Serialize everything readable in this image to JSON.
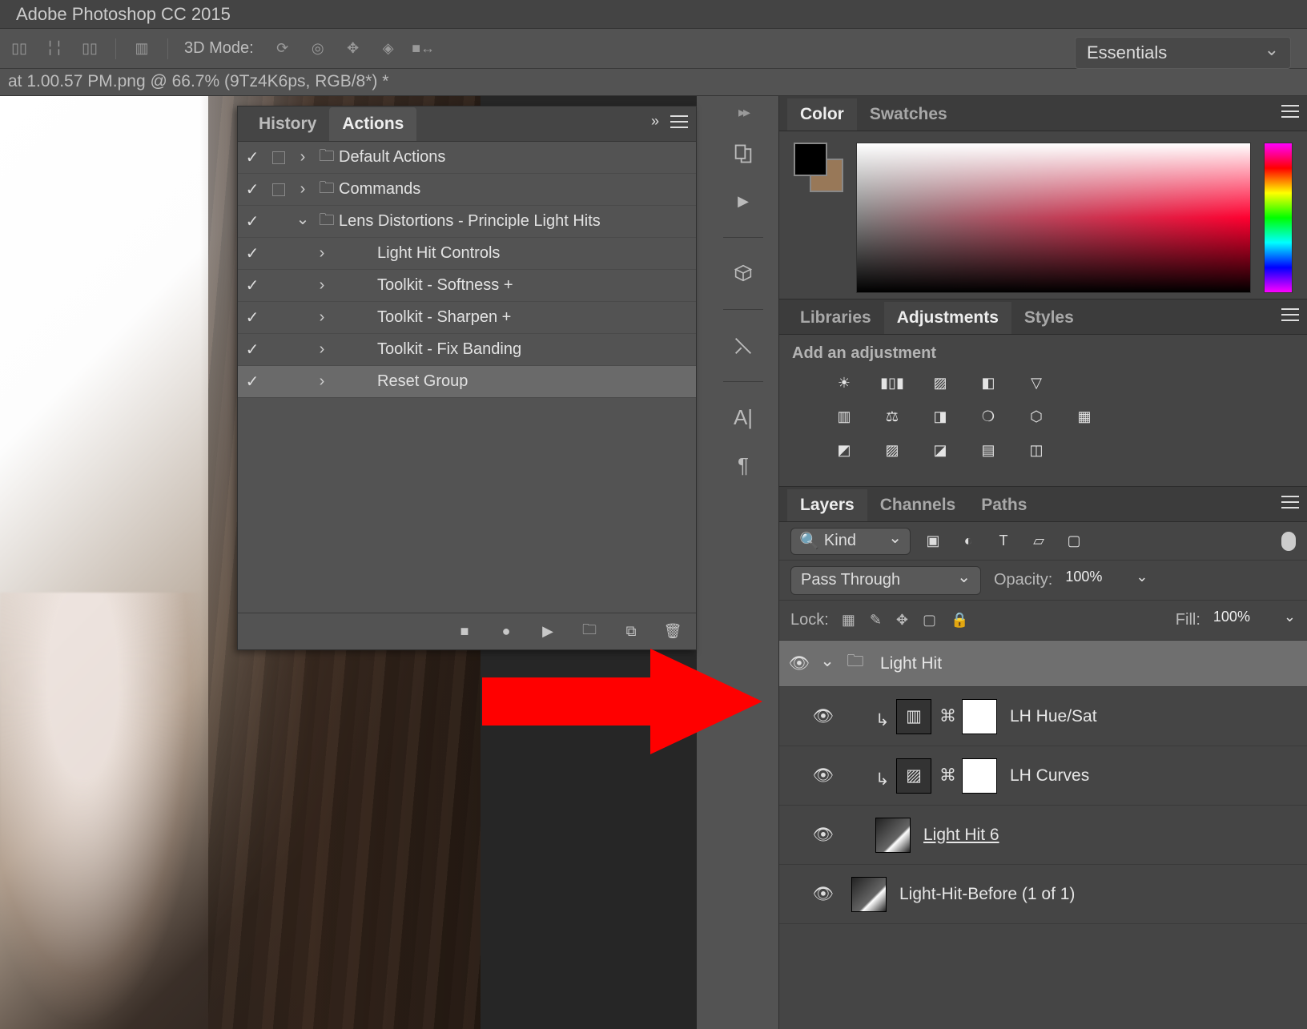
{
  "app": {
    "title": "Adobe Photoshop CC 2015"
  },
  "optbar": {
    "mode_label": "3D Mode:"
  },
  "workspace": {
    "selected": "Essentials"
  },
  "doc_tab": {
    "label": "at 1.00.57 PM.png @ 66.7% (9Tz4K6ps, RGB/8*) *"
  },
  "actions_panel": {
    "tabs": {
      "history": "History",
      "actions": "Actions"
    },
    "rows": [
      {
        "check": true,
        "rec": true,
        "toggle": "right",
        "icon": "folder",
        "label": "Default Actions",
        "indent": 0,
        "sel": false
      },
      {
        "check": true,
        "rec": true,
        "toggle": "right",
        "icon": "folder",
        "label": "Commands",
        "indent": 0,
        "sel": false
      },
      {
        "check": true,
        "rec": false,
        "toggle": "down",
        "icon": "folder",
        "label": "Lens Distortions - Principle Light Hits",
        "indent": 0,
        "sel": false
      },
      {
        "check": true,
        "rec": false,
        "toggle": "right",
        "icon": "",
        "label": "Light Hit Controls",
        "indent": 1,
        "sel": false
      },
      {
        "check": true,
        "rec": false,
        "toggle": "right",
        "icon": "",
        "label": "Toolkit - Softness +",
        "indent": 1,
        "sel": false
      },
      {
        "check": true,
        "rec": false,
        "toggle": "right",
        "icon": "",
        "label": "Toolkit - Sharpen +",
        "indent": 1,
        "sel": false
      },
      {
        "check": true,
        "rec": false,
        "toggle": "right",
        "icon": "",
        "label": "Toolkit - Fix Banding",
        "indent": 1,
        "sel": false
      },
      {
        "check": true,
        "rec": false,
        "toggle": "right",
        "icon": "",
        "label": "Reset Group",
        "indent": 1,
        "sel": true
      }
    ]
  },
  "color_panel": {
    "tabs": {
      "color": "Color",
      "swatches": "Swatches"
    }
  },
  "adjust_panel": {
    "tabs": {
      "libraries": "Libraries",
      "adjustments": "Adjustments",
      "styles": "Styles"
    },
    "hint": "Add an adjustment"
  },
  "layers_panel": {
    "tabs": {
      "layers": "Layers",
      "channels": "Channels",
      "paths": "Paths"
    },
    "filter": {
      "kind": "Kind"
    },
    "blend": {
      "mode": "Pass Through",
      "opacity_label": "Opacity:",
      "opacity_value": "100%",
      "fill_label": "Fill:",
      "fill_value": "100%",
      "lock_label": "Lock:"
    },
    "layers": [
      {
        "type": "group",
        "name": "Light Hit"
      },
      {
        "type": "adj",
        "name": "LH Hue/Sat",
        "clip": true,
        "adj_icon": "huesat"
      },
      {
        "type": "adj",
        "name": "LH Curves",
        "clip": true,
        "adj_icon": "curves"
      },
      {
        "type": "layer",
        "name": "Light Hit 6",
        "underline": true
      },
      {
        "type": "layer",
        "name": "Light-Hit-Before (1 of 1)"
      }
    ]
  }
}
